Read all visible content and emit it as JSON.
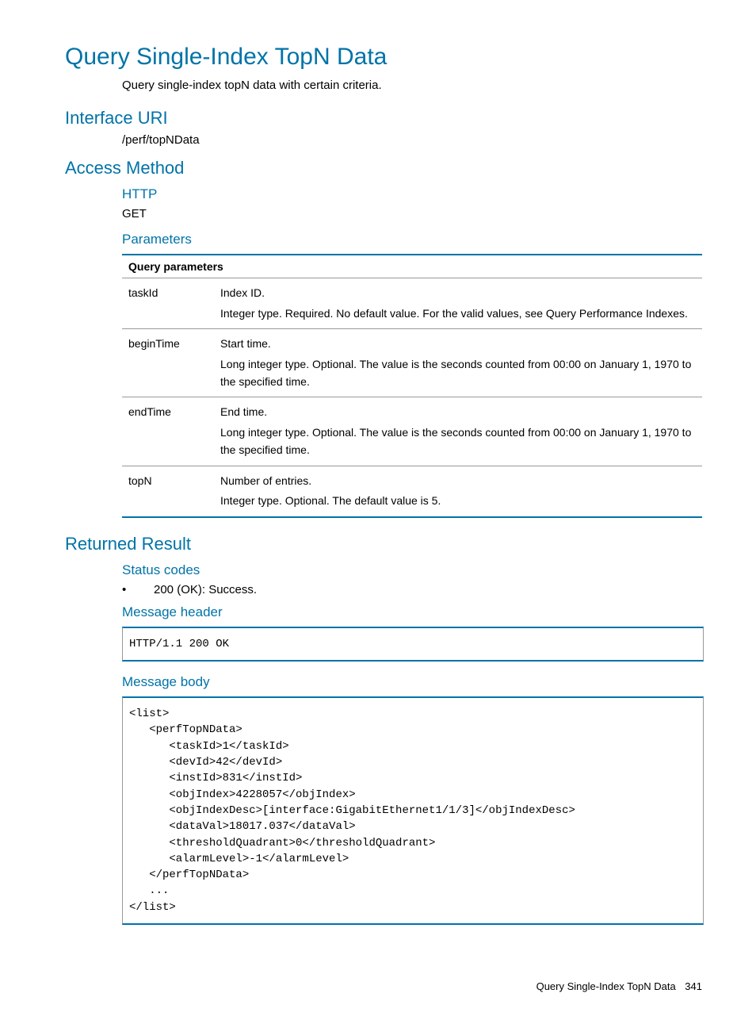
{
  "title": "Query Single-Index TopN Data",
  "intro": "Query single-index topN data with certain criteria.",
  "interface_uri_heading": "Interface URI",
  "interface_uri_value": "/perf/topNData",
  "access_method_heading": "Access Method",
  "http_heading": "HTTP",
  "http_value": "GET",
  "parameters_heading": "Parameters",
  "table_caption": "Query parameters",
  "params": [
    {
      "name": "taskId",
      "line1": "Index ID.",
      "line2": "Integer type. Required. No default value. For the valid values, see Query Performance Indexes."
    },
    {
      "name": "beginTime",
      "line1": "Start time.",
      "line2": "Long integer type. Optional. The value is the seconds counted from 00:00 on January 1, 1970 to the specified time."
    },
    {
      "name": "endTime",
      "line1": "End time.",
      "line2": "Long integer type. Optional. The value is the seconds counted from 00:00 on January 1, 1970 to the specified time."
    },
    {
      "name": "topN",
      "line1": "Number of entries.",
      "line2": "Integer type. Optional. The default value is 5."
    }
  ],
  "returned_result_heading": "Returned Result",
  "status_codes_heading": "Status codes",
  "status_code_item": "200 (OK): Success.",
  "message_header_heading": "Message header",
  "message_header_code": "HTTP/1.1 200 OK",
  "message_body_heading": "Message body",
  "message_body_code": "<list>\n   <perfTopNData>\n      <taskId>1</taskId>\n      <devId>42</devId>\n      <instId>831</instId>\n      <objIndex>4228057</objIndex>\n      <objIndexDesc>[interface:GigabitEthernet1/1/3]</objIndexDesc>\n      <dataVal>18017.037</dataVal>\n      <thresholdQuadrant>0</thresholdQuadrant>\n      <alarmLevel>-1</alarmLevel>\n   </perfTopNData>\n   ...\n</list>",
  "footer_title": "Query Single-Index TopN Data",
  "footer_page": "341"
}
